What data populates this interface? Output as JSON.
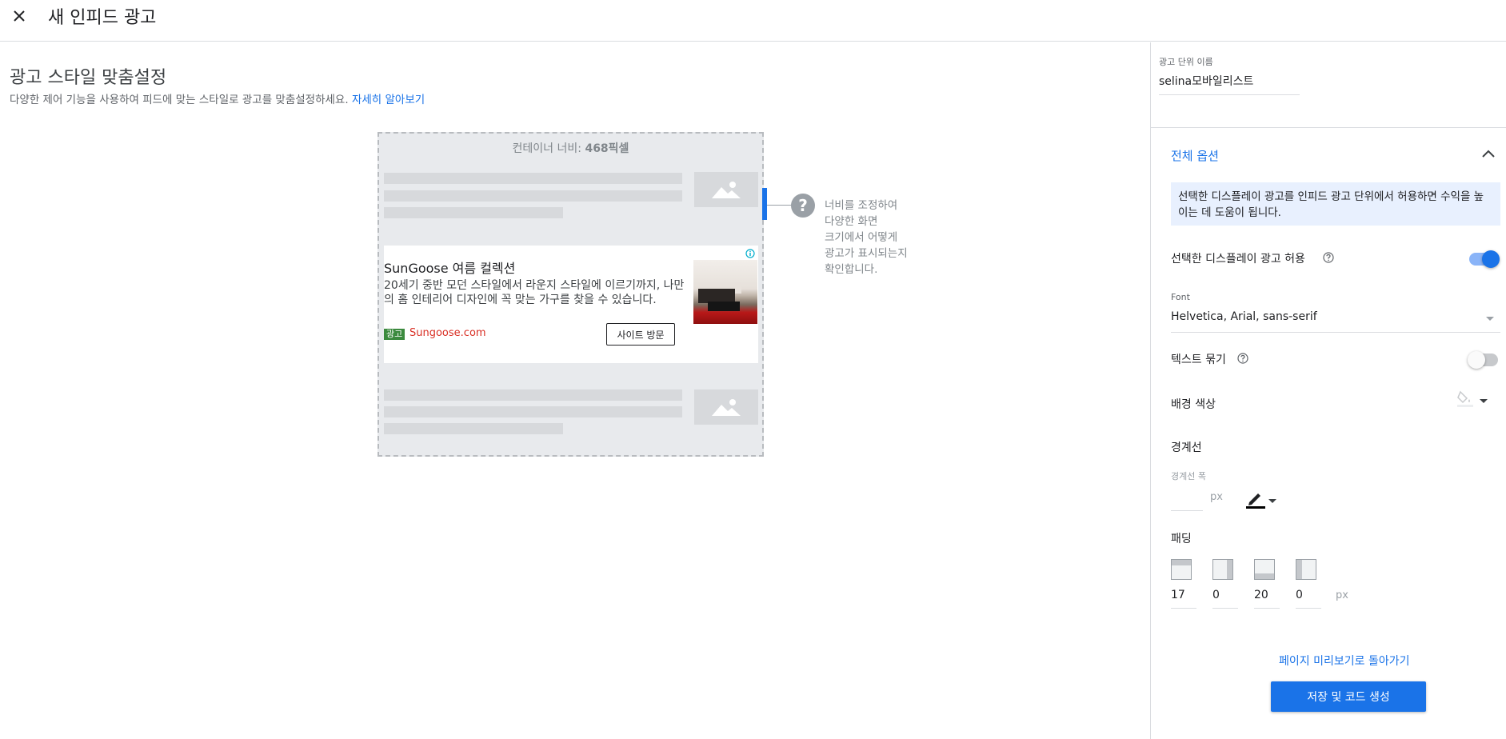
{
  "header": {
    "title": "새 인피드 광고",
    "close_icon": "close-icon"
  },
  "main": {
    "section_title": "광고 스타일 맞춤설정",
    "description": "다양한 제어 기능을 사용하여 피드에 맞는 스타일로 광고를 맞춤설정하세요.",
    "learn_more": "자세히 알아보기",
    "preview": {
      "container_width_label": "컨테이너 너비: ",
      "container_width_value": "468픽셀",
      "help_text": "너비를 조정하여 다양한 화면 크기에서 어떻게 광고가 표시되는지 확인합니다.",
      "ad": {
        "title": "SunGoose 여름 컬렉션",
        "body": "20세기 중반 모던 스타일에서 라운지 스타일에 이르기까지, 나만의 홈 인테리어 디자인에 꼭 맞는 가구를 찾을 수 있습니다.",
        "badge": "광고",
        "url": "Sungoose.com",
        "cta": "사이트 방문"
      }
    }
  },
  "panel": {
    "ad_unit_name_label": "광고 단위 이름",
    "ad_unit_name_value": "selina모바일리스트",
    "options_header": "전체 옵션",
    "info_text": "선택한 디스플레이 광고를 인피드 광고 단위에서 허용하면 수익을 높이는 데 도움이 됩니다.",
    "allow_display_label": "선택한 디스플레이 광고 허용",
    "allow_display_enabled": true,
    "font_label": "Font",
    "font_value": "Helvetica, Arial, sans-serif",
    "bold_text_label": "텍스트 묶기",
    "bold_text_enabled": false,
    "bg_color_label": "배경 색상",
    "border_title": "경계선",
    "border_width_label": "경계선 폭",
    "border_width_value": "",
    "px_unit": "px",
    "padding_title": "패딩",
    "padding": {
      "top": "17",
      "right": "0",
      "bottom": "20",
      "left": "0"
    },
    "back_link": "페이지 미리보기로 돌아가기",
    "save_button": "저장 및 코드 생성"
  },
  "colors": {
    "accent": "#1a73e8",
    "info_bg": "#e8f0fe",
    "ad_badge": "#3b8a3e",
    "ad_url": "#d93025"
  }
}
